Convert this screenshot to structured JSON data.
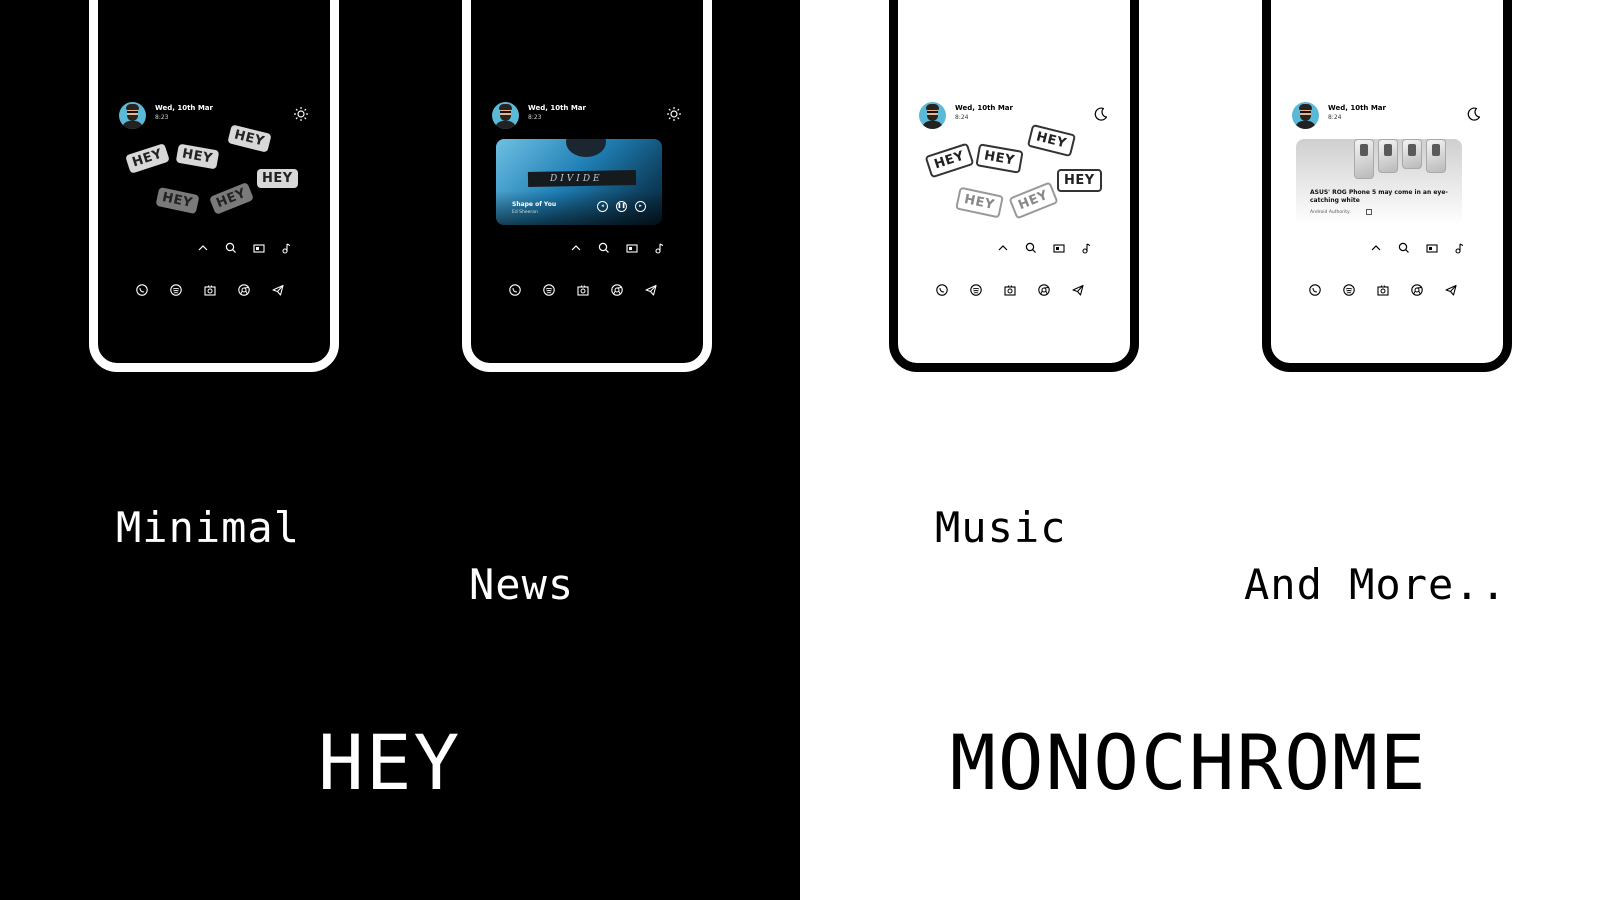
{
  "panels": {
    "dark": {
      "background": "#000000",
      "labels": {
        "minimal": "Minimal",
        "news": "News",
        "title": "HEY"
      }
    },
    "light": {
      "background": "#ffffff",
      "labels": {
        "music": "Music",
        "more": "And More..",
        "title": "MONOCHROME"
      }
    }
  },
  "phones": {
    "dark_1": {
      "date": "Wed, 10th Mar",
      "time": "8:23",
      "mode_icon": "sun-icon",
      "widget": "hey-stickers",
      "hey": [
        "HEY",
        "HEY",
        "HEY",
        "HEY",
        "HEY",
        "HEY"
      ]
    },
    "dark_2": {
      "date": "Wed, 10th Mar",
      "time": "8:23",
      "mode_icon": "sun-icon",
      "widget": "music-player",
      "music": {
        "album_text": "DIVIDE",
        "song": "Shape of You",
        "artist": "Ed Sheeran"
      }
    },
    "light_1": {
      "date": "Wed, 10th Mar",
      "time": "8:24",
      "mode_icon": "moon-icon",
      "widget": "hey-stickers",
      "hey": [
        "HEY",
        "HEY",
        "HEY",
        "HEY",
        "HEY",
        "HEY"
      ]
    },
    "light_2": {
      "date": "Wed, 10th Mar",
      "time": "8:24",
      "mode_icon": "moon-icon",
      "widget": "news",
      "news": {
        "headline": "ASUS' ROG Phone 5 may come in an eye-catching white",
        "source": "Android Authority"
      }
    }
  },
  "shortcut_icons": [
    "chevron-up-icon",
    "search-icon",
    "card-icon",
    "music-note-icon"
  ],
  "dock_icons": [
    "whatsapp-icon",
    "spotify-icon",
    "camera-icon",
    "chrome-icon",
    "telegram-icon"
  ],
  "colors": {
    "dark_bg": "#000000",
    "light_bg": "#ffffff",
    "music_accent": "#1f7fb5"
  }
}
